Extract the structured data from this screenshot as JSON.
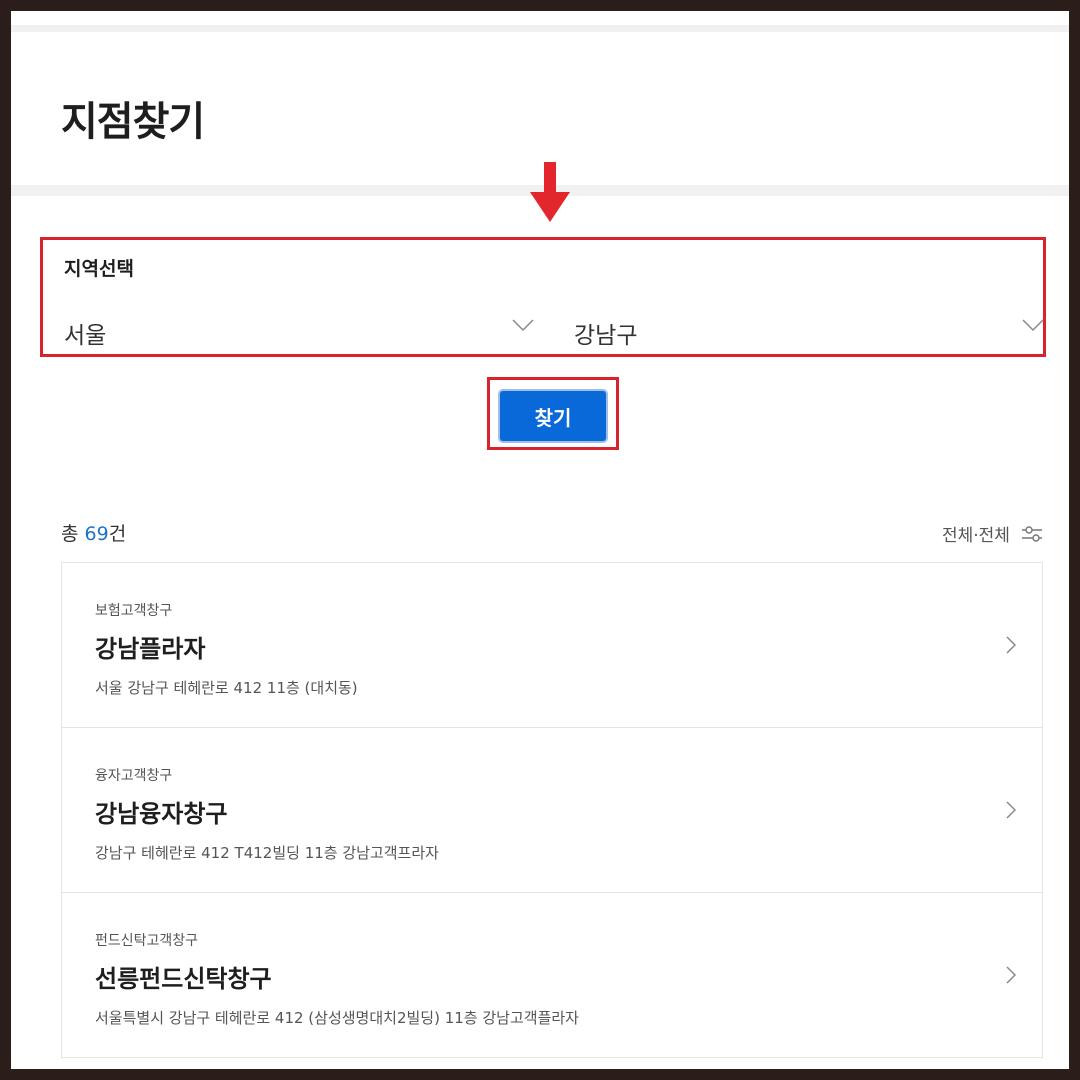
{
  "page": {
    "title": "지점찾기"
  },
  "region": {
    "label": "지역선택",
    "city": "서울",
    "district": "강남구"
  },
  "search": {
    "label": "찾기"
  },
  "results": {
    "count_prefix": "총",
    "count": "69",
    "count_suffix": "건",
    "filter_label": "전체·전체"
  },
  "branches": [
    {
      "type": "보험고객창구",
      "name": "강남플라자",
      "address": "서울 강남구 테헤란로 412 11층 (대치동)"
    },
    {
      "type": "융자고객창구",
      "name": "강남융자창구",
      "address": "강남구 테헤란로 412 T412빌딩 11층 강남고객프라자"
    },
    {
      "type": "펀드신탁고객창구",
      "name": "선릉펀드신탁창구",
      "address": "서울특별시 강남구 테헤란로 412 (삼성생명대치2빌딩) 11층 강남고객플라자"
    }
  ],
  "colors": {
    "accent_blue": "#0a69d9",
    "count_blue": "#1a73d0",
    "annotation_red": "#d7232b"
  },
  "icons": [
    "down-arrow-annotation-icon",
    "chevron-down-icon",
    "filter-icon",
    "chevron-right-icon"
  ]
}
